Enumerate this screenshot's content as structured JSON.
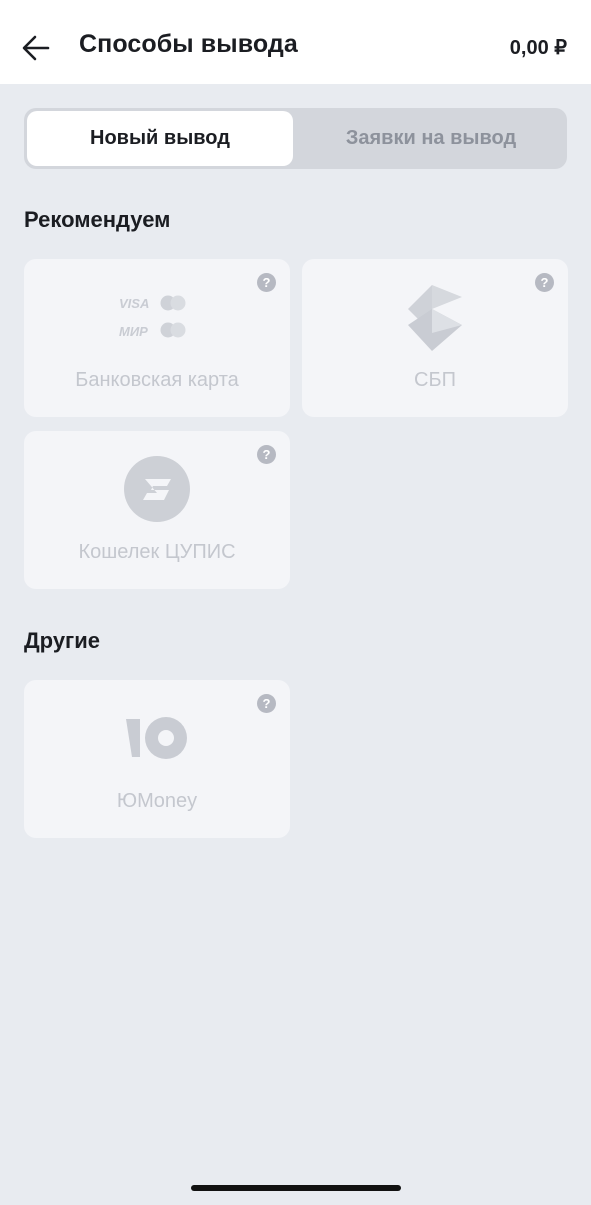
{
  "header": {
    "title": "Способы вывода",
    "balance": "0,00 ₽"
  },
  "tabs": [
    {
      "label": "Новый вывод",
      "active": true
    },
    {
      "label": "Заявки на вывод",
      "active": false
    }
  ],
  "sections": {
    "recommended": {
      "title": "Рекомендуем",
      "cards": [
        {
          "label": "Банковская карта",
          "icon": "bank-card-icon",
          "brands": [
            "VISA",
            "МИР"
          ]
        },
        {
          "label": "СБП",
          "icon": "sbp-icon"
        },
        {
          "label": "Кошелек ЦУПИС",
          "icon": "cupis-icon"
        }
      ]
    },
    "others": {
      "title": "Другие",
      "cards": [
        {
          "label": "ЮMoney",
          "icon": "yumoney-icon"
        }
      ]
    }
  },
  "help_symbol": "?",
  "colors": {
    "background": "#e8ebf0",
    "card": "#f4f5f8",
    "help_badge": "#b6b9c2",
    "disabled_text": "#c4c7ce"
  }
}
